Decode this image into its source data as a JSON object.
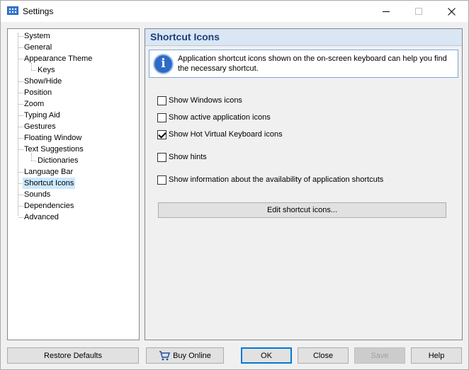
{
  "window": {
    "title": "Settings"
  },
  "tree": {
    "items": [
      {
        "label": "System"
      },
      {
        "label": "General"
      },
      {
        "label": "Appearance Theme"
      },
      {
        "label": "Keys"
      },
      {
        "label": "Show/Hide"
      },
      {
        "label": "Position"
      },
      {
        "label": "Zoom"
      },
      {
        "label": "Typing Aid"
      },
      {
        "label": "Gestures"
      },
      {
        "label": "Floating Window"
      },
      {
        "label": "Text Suggestions"
      },
      {
        "label": "Dictionaries"
      },
      {
        "label": "Language Bar"
      },
      {
        "label": "Shortcut Icons"
      },
      {
        "label": "Sounds"
      },
      {
        "label": "Dependencies"
      },
      {
        "label": "Advanced"
      }
    ],
    "selected": "Shortcut Icons"
  },
  "panel": {
    "title": "Shortcut Icons",
    "info_line1": "Application shortcut icons shown on the on-screen keyboard can help you find",
    "info_line2": "the necessary shortcut.",
    "options": [
      {
        "label": "Show Windows icons",
        "checked": false
      },
      {
        "label": "Show active application icons",
        "checked": false
      },
      {
        "label": "Show Hot Virtual Keyboard icons",
        "checked": true
      },
      {
        "label": "Show hints",
        "checked": false
      },
      {
        "label": "Show information about the availability of application shortcuts",
        "checked": false
      }
    ],
    "edit_button": "Edit shortcut icons..."
  },
  "footer": {
    "restore_defaults": "Restore Defaults",
    "buy_online": "Buy Online",
    "ok": "OK",
    "close": "Close",
    "save": "Save",
    "help": "Help"
  }
}
